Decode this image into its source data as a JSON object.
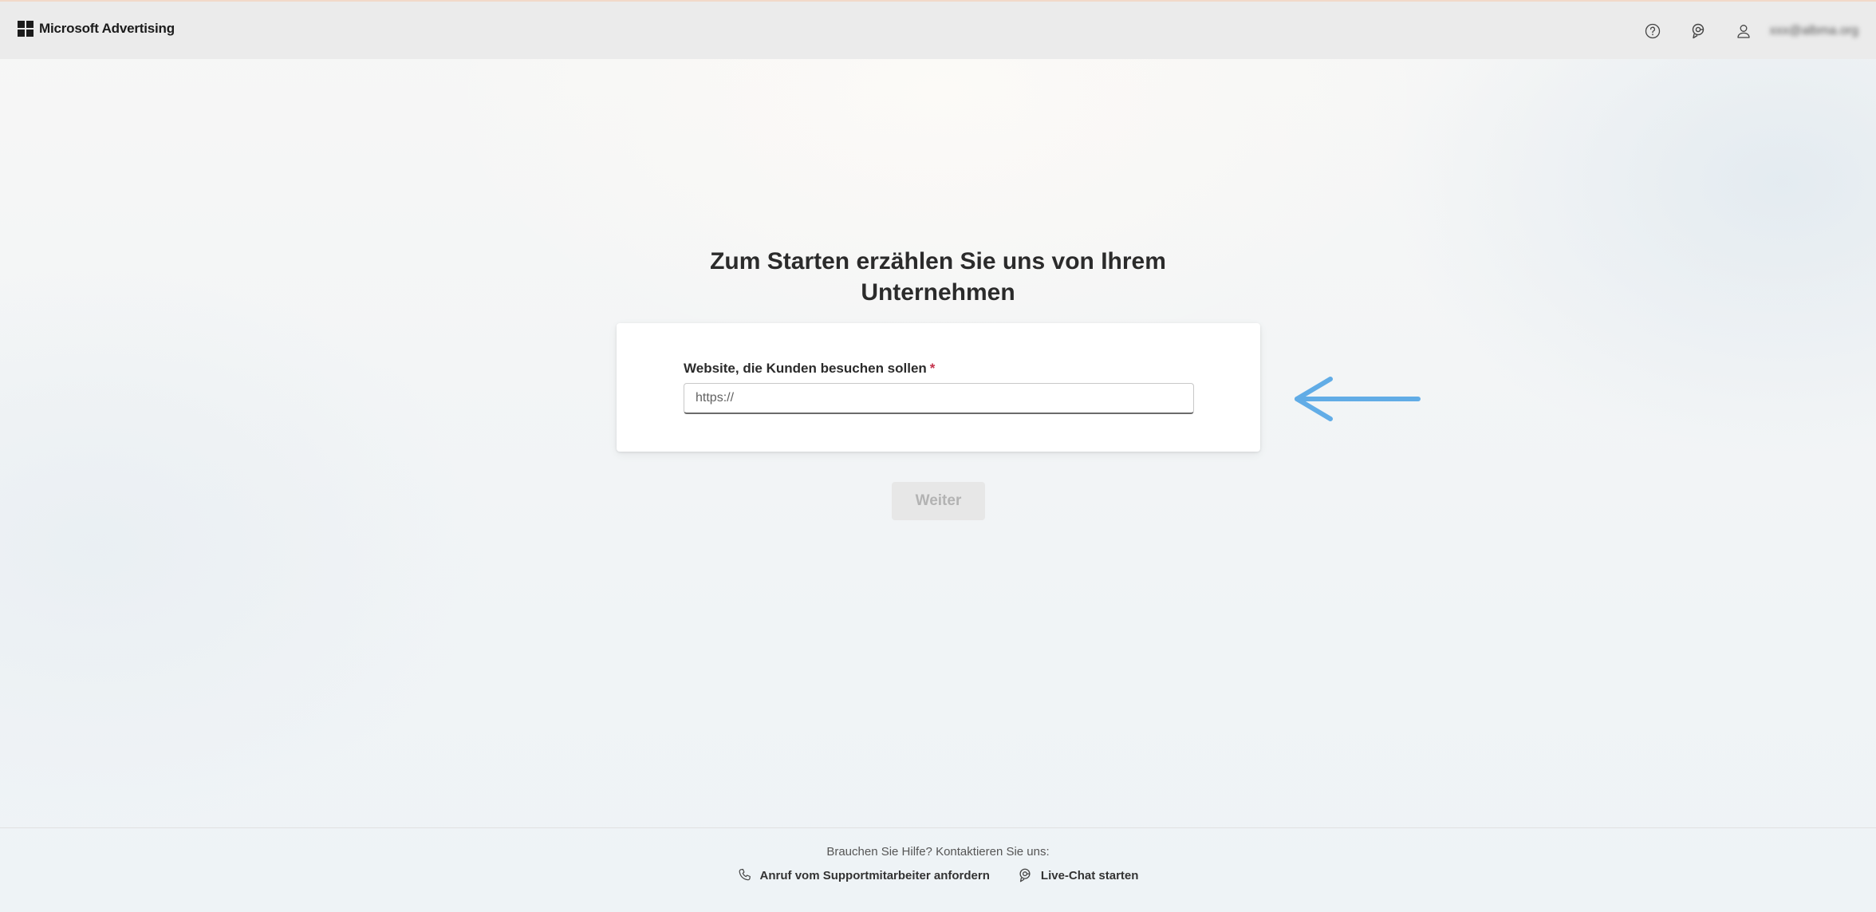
{
  "header": {
    "brand": "Microsoft Advertising",
    "icons": [
      "help-icon",
      "chat-support-icon",
      "user-icon"
    ],
    "user_email": "xxx@albma.org"
  },
  "main": {
    "title": "Zum Starten erzählen Sie uns von Ihrem Unternehmen",
    "form": {
      "website_label": "Website, die Kunden besuchen sollen",
      "required_marker": "*",
      "website_value": "",
      "website_placeholder": "https://"
    },
    "next_button": "Weiter"
  },
  "footer": {
    "help_text": "Brauchen Sie Hilfe? Kontaktieren Sie uns:",
    "call_link": "Anruf vom Supportmitarbeiter anfordern",
    "chat_link": "Live-Chat starten"
  },
  "colors": {
    "annotation_arrow": "#5aa9e6",
    "required": "#c4314b",
    "header_bg": "#ebebeb"
  }
}
